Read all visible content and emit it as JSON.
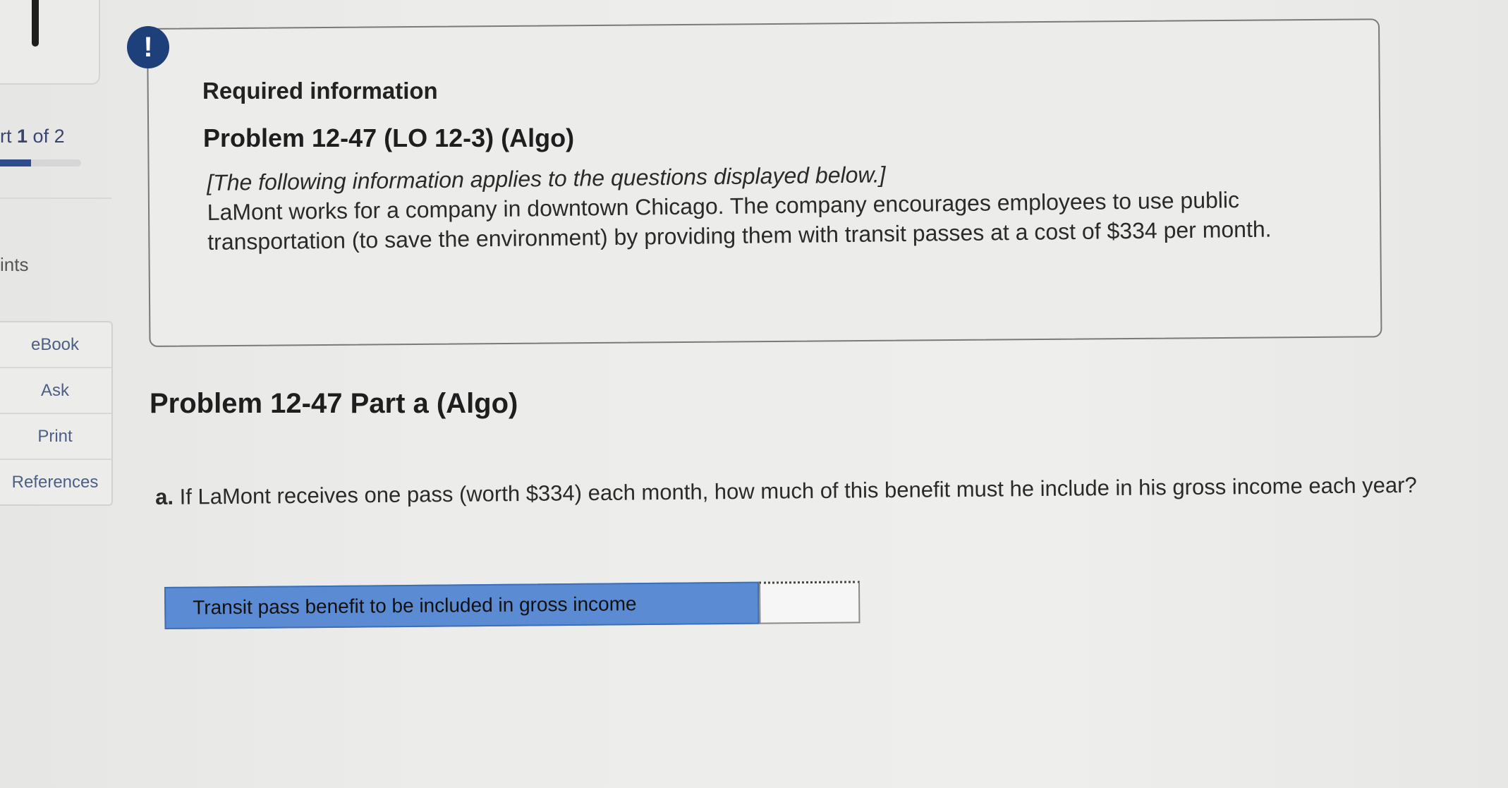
{
  "sidebar": {
    "part_prefix": "rt",
    "part_current": "1",
    "part_suffix": " of 2",
    "progress": 0.5,
    "points_label": "ints",
    "tools": [
      {
        "label": "eBook"
      },
      {
        "label": "Ask"
      },
      {
        "label": "Print"
      },
      {
        "label": "References"
      }
    ]
  },
  "info": {
    "badge": "!",
    "required_title": "Required information",
    "problem_title": "Problem 12-47 (LO 12-3) (Algo)",
    "intro": "[The following information applies to the questions displayed below.]",
    "body": "LaMont works for a company in downtown Chicago. The company encourages employees to use public transportation (to save the environment) by providing them with transit passes at a cost of $334 per month."
  },
  "part_a": {
    "title": "Problem 12-47 Part a (Algo)",
    "question_prefix": "a.",
    "question_text": " If LaMont receives one pass (worth $334) each month, how much of this benefit must he include in his gross income each year?",
    "answer_label": "Transit pass benefit to be included in gross income",
    "answer_value": ""
  },
  "colors": {
    "accent": "#1d3f7a",
    "answer_label_bg": "#5b8bd3",
    "sidebar_link": "#4c5f86"
  }
}
